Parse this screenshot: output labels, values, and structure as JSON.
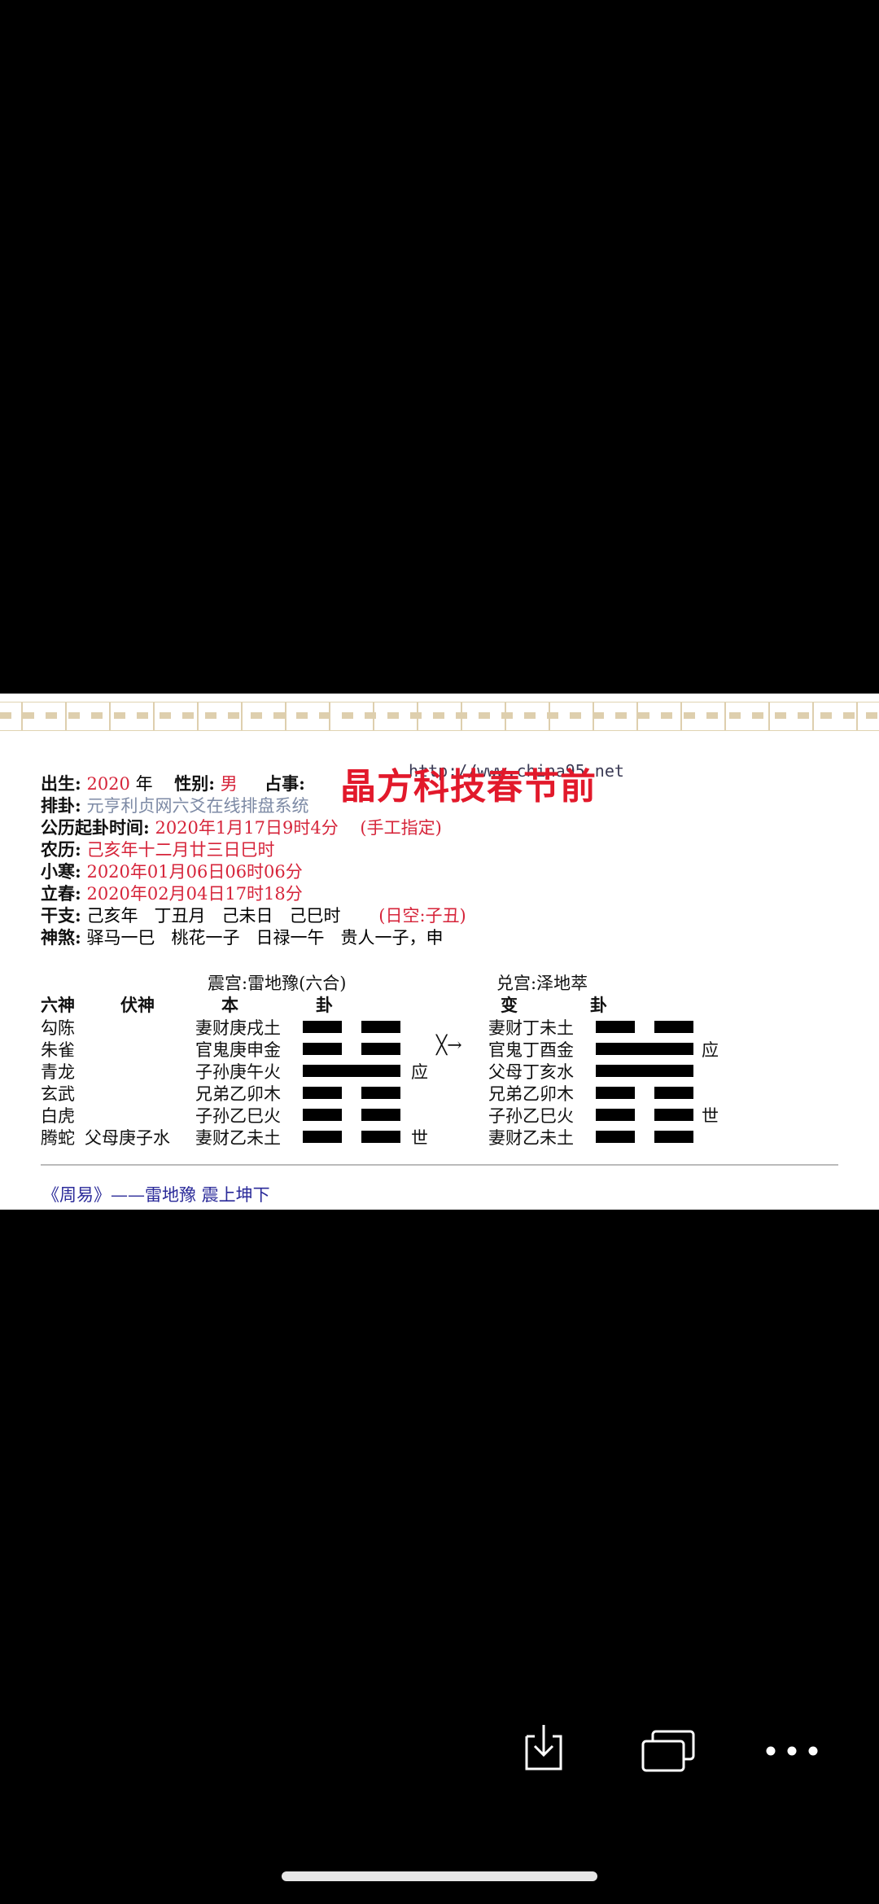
{
  "header": {
    "birth_label": "出生:",
    "birth_year": "2020",
    "year_unit": "年",
    "gender_label": "性别:",
    "gender": "男",
    "matter_label": "占事:",
    "matter": "晶方科技春节前"
  },
  "paipan": {
    "label": "排卦:",
    "system": "元亨利贞网六爻在线排盘系统",
    "url": "http://www.china95.net"
  },
  "time": {
    "label": "公历起卦时间:",
    "value": "2020年1月17日9时4分",
    "note": "(手工指定)"
  },
  "lunar": {
    "label": "农历:",
    "value": "己亥年十二月廿三日巳时"
  },
  "xiaohan": {
    "label": "小寒:",
    "value": "2020年01月06日06时06分"
  },
  "lichun": {
    "label": "立春:",
    "value": "2020年02月04日17时18分"
  },
  "ganzhi": {
    "label": "干支:",
    "year": "己亥年",
    "month": "丁丑月",
    "day": "己未日",
    "hour": "己巳时",
    "kong": "(日空:子丑)"
  },
  "shensha": {
    "label": "神煞:",
    "yima": "驿马一巳",
    "taohua": "桃花一子",
    "rilu": "日禄一午",
    "guiren": "贵人一子，申"
  },
  "gua": {
    "ben_title": "震宫:雷地豫(六合)",
    "bian_title": "兑宫:泽地萃",
    "col_liushen": "六神",
    "col_fushen": "伏神",
    "col_ben": "本",
    "col_gua": "卦",
    "col_bian": "变",
    "col_gua2": "卦",
    "arrow": "╳→",
    "rows": [
      {
        "liushen": "勾陈",
        "fushen": "",
        "ben": "妻财庚戌土",
        "ben_line": "yin",
        "ben_mark": "",
        "bian": "妻财丁未土",
        "bian_line": "yin",
        "bian_mark": ""
      },
      {
        "liushen": "朱雀",
        "fushen": "",
        "ben": "官鬼庚申金",
        "ben_line": "yin",
        "ben_mark": "",
        "bian": "官鬼丁酉金",
        "bian_line": "yang",
        "bian_mark": "应"
      },
      {
        "liushen": "青龙",
        "fushen": "",
        "ben": "子孙庚午火",
        "ben_line": "yang",
        "ben_mark": "应",
        "bian": "父母丁亥水",
        "bian_line": "yang",
        "bian_mark": ""
      },
      {
        "liushen": "玄武",
        "fushen": "",
        "ben": "兄弟乙卯木",
        "ben_line": "yin",
        "ben_mark": "",
        "bian": "兄弟乙卯木",
        "bian_line": "yin",
        "bian_mark": ""
      },
      {
        "liushen": "白虎",
        "fushen": "",
        "ben": "子孙乙巳火",
        "ben_line": "yin",
        "ben_mark": "",
        "bian": "子孙乙巳火",
        "bian_line": "yin",
        "bian_mark": "世"
      },
      {
        "liushen": "腾蛇",
        "fushen": "父母庚子水",
        "ben": "妻财乙未土",
        "ben_line": "yin",
        "ben_mark": "世",
        "bian": "妻财乙未土",
        "bian_line": "yin",
        "bian_mark": ""
      }
    ]
  },
  "footer": {
    "book": "《周易》——雷地豫 震上坤下"
  },
  "toolbar": {
    "download_icon": "download-icon",
    "windows_icon": "windows-icon",
    "more_icon": "more-icon"
  }
}
